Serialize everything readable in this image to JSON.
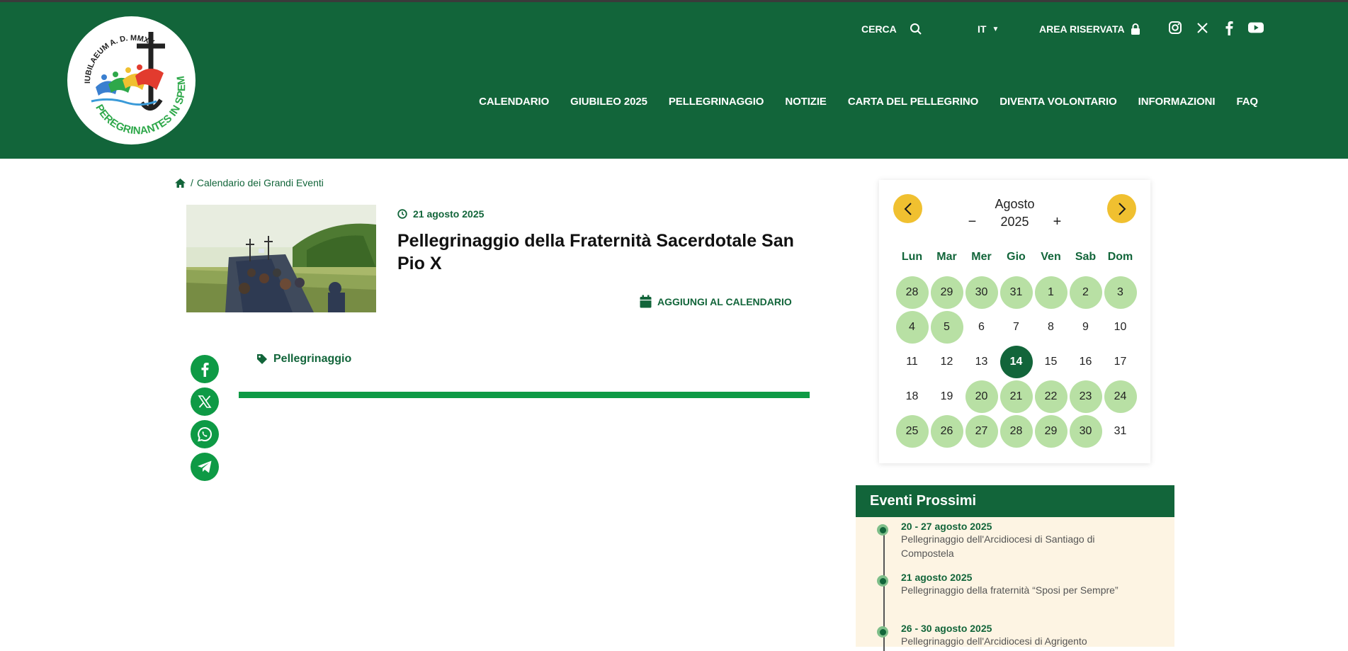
{
  "header": {
    "search_label": "CERCA",
    "lang_label": "IT",
    "area_label": "AREA RISERVATA",
    "logo_text": "IUBILAEUM A.D. MMXXV · PEREGRINANTES IN SPEM",
    "nav": [
      "CALENDARIO",
      "GIUBILEO 2025",
      "PELLEGRINAGGIO",
      "NOTIZIE",
      "CARTA DEL PELLEGRINO",
      "DIVENTA VOLONTARIO",
      "INFORMAZIONI",
      "FAQ"
    ],
    "social_icons": [
      "instagram-icon",
      "x-icon",
      "facebook-icon",
      "youtube-icon"
    ]
  },
  "breadcrumb": {
    "sep": "/",
    "current": "Calendario dei Grandi Eventi"
  },
  "event": {
    "date": "21 agosto 2025",
    "title": "Pellegrinaggio della Fraternità Sacerdotale San Pio X",
    "add_calendar": "AGGIUNGI AL CALENDARIO",
    "tag": "Pellegrinaggio"
  },
  "share_icons": [
    "facebook-icon",
    "x-icon",
    "whatsapp-icon",
    "telegram-icon"
  ],
  "calendar": {
    "month": "Agosto",
    "year": "2025",
    "minus": "−",
    "plus": "+",
    "weekdays": [
      "Lun",
      "Mar",
      "Mer",
      "Gio",
      "Ven",
      "Sab",
      "Dom"
    ],
    "days": [
      {
        "d": "28",
        "t": "ev"
      },
      {
        "d": "29",
        "t": "ev"
      },
      {
        "d": "30",
        "t": "ev"
      },
      {
        "d": "31",
        "t": "ev"
      },
      {
        "d": "1",
        "t": "ev"
      },
      {
        "d": "2",
        "t": "ev"
      },
      {
        "d": "3",
        "t": "ev"
      },
      {
        "d": "4",
        "t": "ev"
      },
      {
        "d": "5",
        "t": "ev"
      },
      {
        "d": "6",
        "t": ""
      },
      {
        "d": "7",
        "t": ""
      },
      {
        "d": "8",
        "t": ""
      },
      {
        "d": "9",
        "t": ""
      },
      {
        "d": "10",
        "t": ""
      },
      {
        "d": "11",
        "t": ""
      },
      {
        "d": "12",
        "t": ""
      },
      {
        "d": "13",
        "t": ""
      },
      {
        "d": "14",
        "t": "today"
      },
      {
        "d": "15",
        "t": ""
      },
      {
        "d": "16",
        "t": ""
      },
      {
        "d": "17",
        "t": ""
      },
      {
        "d": "18",
        "t": ""
      },
      {
        "d": "19",
        "t": ""
      },
      {
        "d": "20",
        "t": "ev"
      },
      {
        "d": "21",
        "t": "ev"
      },
      {
        "d": "22",
        "t": "ev"
      },
      {
        "d": "23",
        "t": "ev"
      },
      {
        "d": "24",
        "t": "ev"
      },
      {
        "d": "25",
        "t": "ev"
      },
      {
        "d": "26",
        "t": "ev"
      },
      {
        "d": "27",
        "t": "ev"
      },
      {
        "d": "28",
        "t": "ev"
      },
      {
        "d": "29",
        "t": "ev"
      },
      {
        "d": "30",
        "t": "ev"
      },
      {
        "d": "31",
        "t": ""
      }
    ]
  },
  "upcoming": {
    "title": "Eventi Prossimi",
    "items": [
      {
        "date": "20 - 27 agosto 2025",
        "title": "Pellegrinaggio dell'Arcidiocesi di Santiago di Compostela"
      },
      {
        "date": "21 agosto 2025",
        "title": "Pellegrinaggio della fraternità “Sposi per Sempre”"
      },
      {
        "date": "26 - 30 agosto 2025",
        "title": "Pellegrinaggio dell'Arcidiocesi di Agrigento"
      }
    ]
  },
  "colors": {
    "brand_green": "#12653a",
    "accent_green": "#0e9a45",
    "event_day": "#b8e0a4",
    "nav_yellow": "#f0c030",
    "panel_cream": "#fdf4e3"
  }
}
